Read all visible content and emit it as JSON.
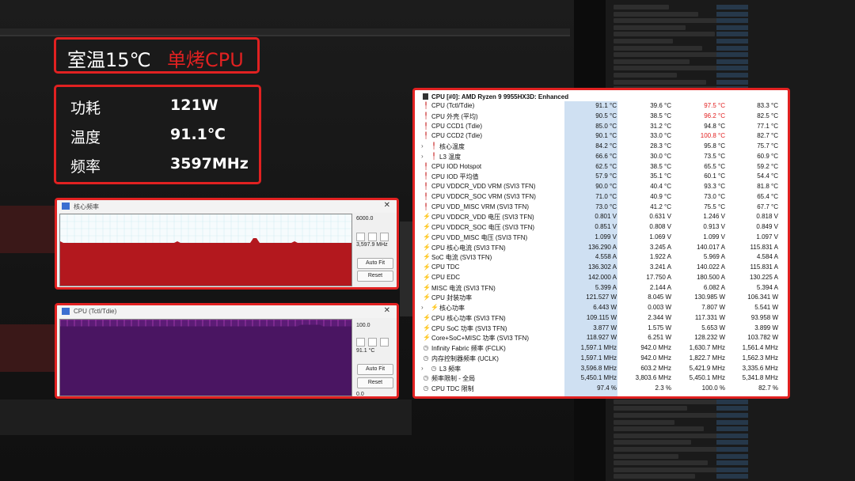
{
  "banner": {
    "room_temp": "室温15℃",
    "mode": "单烤CPU"
  },
  "stats": [
    {
      "label": "功耗",
      "value": "121W"
    },
    {
      "label": "温度",
      "value": "91.1℃"
    },
    {
      "label": "频率",
      "value": "3597MHz"
    }
  ],
  "graph_freq": {
    "title": "核心频率",
    "max_label": "6000.0",
    "current_label": "3,597.9 MHz",
    "autofit": "Auto Fit",
    "reset": "Reset",
    "fill_color": "#b3181e",
    "grid_color": "#d6eef4",
    "level_fraction": 0.6
  },
  "graph_temp": {
    "title": "CPU (Tctl/Tdie)",
    "max_label": "100.0",
    "current_label": "91.1 °C",
    "min_label": "0.0",
    "autofit": "Auto Fit",
    "reset": "Reset",
    "fill_color": "#4a1562",
    "grid_color": "#c84bc8",
    "level_fraction": 0.911
  },
  "hwinfo": {
    "header": "CPU [#0]: AMD Ryzen 9 9955HX3D: Enhanced",
    "rows": [
      {
        "icon": "temp",
        "name": "CPU (Tctl/Tdie)",
        "cur": "91.1 °C",
        "min": "39.6 °C",
        "max": "97.5 °C",
        "avg": "83.3 °C",
        "hot": "max"
      },
      {
        "icon": "temp",
        "name": "CPU 外壳 (平均)",
        "cur": "90.5 °C",
        "min": "38.5 °C",
        "max": "96.2 °C",
        "avg": "82.5 °C",
        "hot": "max"
      },
      {
        "icon": "temp",
        "name": "CPU CCD1 (Tdie)",
        "cur": "85.0 °C",
        "min": "31.2 °C",
        "max": "94.8 °C",
        "avg": "77.1 °C"
      },
      {
        "icon": "temp",
        "name": "CPU CCD2 (Tdie)",
        "cur": "90.1 °C",
        "min": "33.0 °C",
        "max": "100.8 °C",
        "avg": "82.7 °C",
        "hot": "max"
      },
      {
        "icon": "temp",
        "name": "核心温度",
        "cur": "84.2 °C",
        "min": "28.3 °C",
        "max": "95.8 °C",
        "avg": "75.7 °C",
        "expand": true
      },
      {
        "icon": "temp",
        "name": "L3 温度",
        "cur": "66.6 °C",
        "min": "30.0 °C",
        "max": "73.5 °C",
        "avg": "60.9 °C",
        "expand": true
      },
      {
        "icon": "temp",
        "name": "CPU IOD Hotspot",
        "cur": "62.5 °C",
        "min": "38.5 °C",
        "max": "65.5 °C",
        "avg": "59.2 °C"
      },
      {
        "icon": "temp",
        "name": "CPU IOD 平均值",
        "cur": "57.9 °C",
        "min": "35.1 °C",
        "max": "60.1 °C",
        "avg": "54.4 °C"
      },
      {
        "icon": "temp",
        "name": "CPU VDDCR_VDD VRM (SVI3 TFN)",
        "cur": "90.0 °C",
        "min": "40.4 °C",
        "max": "93.3 °C",
        "avg": "81.8 °C"
      },
      {
        "icon": "temp",
        "name": "CPU VDDCR_SOC VRM (SVI3 TFN)",
        "cur": "71.0 °C",
        "min": "40.9 °C",
        "max": "73.0 °C",
        "avg": "65.4 °C"
      },
      {
        "icon": "temp",
        "name": "CPU VDD_MISC VRM (SVI3 TFN)",
        "cur": "73.0 °C",
        "min": "41.2 °C",
        "max": "75.5 °C",
        "avg": "67.7 °C"
      },
      {
        "icon": "bolt",
        "name": "CPU VDDCR_VDD 电压 (SVI3 TFN)",
        "cur": "0.801 V",
        "min": "0.631 V",
        "max": "1.246 V",
        "avg": "0.818 V"
      },
      {
        "icon": "bolt",
        "name": "CPU VDDCR_SOC 电压 (SVI3 TFN)",
        "cur": "0.851 V",
        "min": "0.808 V",
        "max": "0.913 V",
        "avg": "0.849 V"
      },
      {
        "icon": "bolt",
        "name": "CPU VDD_MISC 电压 (SVI3 TFN)",
        "cur": "1.099 V",
        "min": "1.069 V",
        "max": "1.099 V",
        "avg": "1.097 V"
      },
      {
        "icon": "bolt",
        "name": "CPU 核心电流 (SVI3 TFN)",
        "cur": "136.290 A",
        "min": "3.245 A",
        "max": "140.017 A",
        "avg": "115.831 A"
      },
      {
        "icon": "bolt",
        "name": "SoC 电流 (SVI3 TFN)",
        "cur": "4.558 A",
        "min": "1.922 A",
        "max": "5.969 A",
        "avg": "4.584 A"
      },
      {
        "icon": "bolt",
        "name": "CPU TDC",
        "cur": "136.302 A",
        "min": "3.241 A",
        "max": "140.022 A",
        "avg": "115.831 A"
      },
      {
        "icon": "bolt",
        "name": "CPU EDC",
        "cur": "142.000 A",
        "min": "17.750 A",
        "max": "180.500 A",
        "avg": "130.225 A"
      },
      {
        "icon": "bolt",
        "name": "MISC 电流 (SVI3 TFN)",
        "cur": "5.399 A",
        "min": "2.144 A",
        "max": "6.082 A",
        "avg": "5.394 A"
      },
      {
        "icon": "bolt",
        "name": "CPU 封装功率",
        "cur": "121.527 W",
        "min": "8.045 W",
        "max": "130.985 W",
        "avg": "106.341 W"
      },
      {
        "icon": "bolt",
        "name": "核心功率",
        "cur": "6.443 W",
        "min": "0.003 W",
        "max": "7.807 W",
        "avg": "5.541 W",
        "expand": true
      },
      {
        "icon": "bolt",
        "name": "CPU 核心功率 (SVI3 TFN)",
        "cur": "109.115 W",
        "min": "2.344 W",
        "max": "117.331 W",
        "avg": "93.958 W"
      },
      {
        "icon": "bolt",
        "name": "CPU SoC 功率 (SVI3 TFN)",
        "cur": "3.877 W",
        "min": "1.575 W",
        "max": "5.653 W",
        "avg": "3.899 W"
      },
      {
        "icon": "bolt",
        "name": "Core+SoC+MISC 功率 (SVI3 TFN)",
        "cur": "118.927 W",
        "min": "6.251 W",
        "max": "128.232 W",
        "avg": "103.782 W"
      },
      {
        "icon": "clock",
        "name": "Infinity Fabric 频率 (FCLK)",
        "cur": "1,597.1 MHz",
        "min": "942.0 MHz",
        "max": "1,630.7 MHz",
        "avg": "1,561.4 MHz"
      },
      {
        "icon": "clock",
        "name": "内存控制器频率 (UCLK)",
        "cur": "1,597.1 MHz",
        "min": "942.0 MHz",
        "max": "1,822.7 MHz",
        "avg": "1,562.3 MHz"
      },
      {
        "icon": "clock",
        "name": "L3 频率",
        "cur": "3,596.8 MHz",
        "min": "603.2 MHz",
        "max": "5,421.9 MHz",
        "avg": "3,335.6 MHz",
        "expand": true
      },
      {
        "icon": "clock",
        "name": "频率限制 - 全局",
        "cur": "5,450.1 MHz",
        "min": "3,803.6 MHz",
        "max": "5,450.1 MHz",
        "avg": "5,341.8 MHz"
      },
      {
        "icon": "clock",
        "name": "CPU TDC 限制",
        "cur": "97.4 %",
        "min": "2.3 %",
        "max": "100.0 %",
        "avg": "82.7 %"
      }
    ]
  }
}
